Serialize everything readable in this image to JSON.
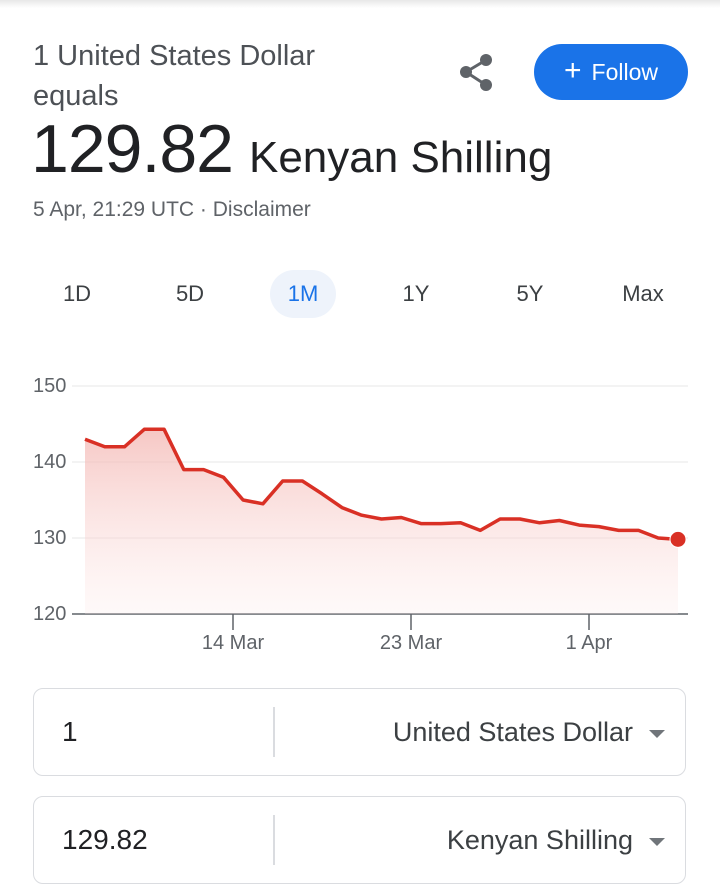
{
  "header": {
    "equals_text": "1 United States Dollar equals",
    "rate": "129.82",
    "target_currency": "Kenyan Shilling",
    "timestamp": "5 Apr, 21:29 UTC",
    "separator": " · ",
    "disclaimer": "Disclaimer",
    "follow_label": "Follow",
    "share_icon": "share-icon"
  },
  "tabs": [
    {
      "label": "1D",
      "active": false
    },
    {
      "label": "5D",
      "active": false
    },
    {
      "label": "1M",
      "active": true
    },
    {
      "label": "1Y",
      "active": false
    },
    {
      "label": "5Y",
      "active": false
    },
    {
      "label": "Max",
      "active": false
    }
  ],
  "chart_data": {
    "type": "area",
    "ylim": [
      120,
      150
    ],
    "yticks": [
      150,
      140,
      130,
      120
    ],
    "xticks": [
      "14 Mar",
      "23 Mar",
      "1 Apr"
    ],
    "color": "#d93025",
    "grid": true,
    "series": [
      {
        "values": [
          143.0,
          142.0,
          142.0,
          144.3,
          144.3,
          139.0,
          139.0,
          138.0,
          135.0,
          134.5,
          137.5,
          137.5,
          135.8,
          134.0,
          133.0,
          132.5,
          132.7,
          131.9,
          131.9,
          132.0,
          131.0,
          132.5,
          132.5,
          132.0,
          132.3,
          131.7,
          131.5,
          131.0,
          131.0,
          130.0,
          129.82
        ]
      }
    ]
  },
  "converter": {
    "from_amount": "1",
    "from_currency": "United States Dollar",
    "to_amount": "129.82",
    "to_currency": "Kenyan Shilling"
  }
}
